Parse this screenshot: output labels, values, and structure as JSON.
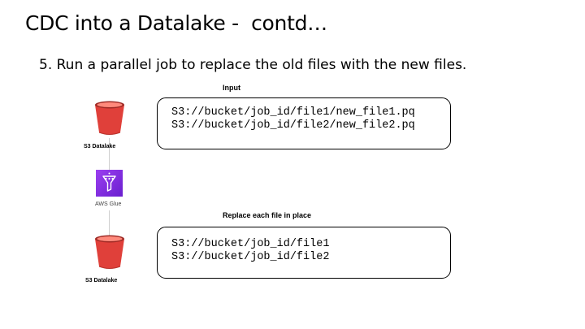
{
  "slide": {
    "title": "CDC into a Datalake -  contd…",
    "step": "5. Run a parallel job to replace the old files with the new files."
  },
  "input_section": {
    "heading": "Input",
    "lines": [
      "S3://bucket/job_id/file1/new_file1.pq",
      "S3://bucket/job_id/file2/new_file2.pq"
    ]
  },
  "output_section": {
    "heading": "Replace each file in place",
    "lines": [
      "S3://bucket/job_id/file1",
      "S3://bucket/job_id/file2"
    ]
  },
  "nodes": {
    "source": {
      "label": "S3 Datalake",
      "icon": "s3-bucket-icon"
    },
    "glue": {
      "label": "AWS Glue",
      "icon": "aws-glue-icon"
    },
    "target": {
      "label": "S3 Datalake",
      "icon": "s3-bucket-icon"
    }
  },
  "colors": {
    "bucket_red": "#e0403a",
    "bucket_dark": "#9e2a25",
    "glue_purple": "#8a32e8",
    "connector": "#cfcfcf"
  }
}
